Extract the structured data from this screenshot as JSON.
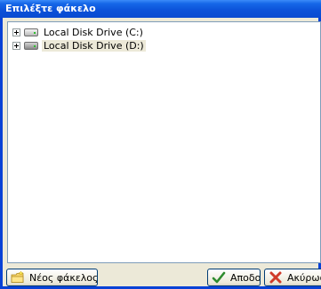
{
  "dialog": {
    "title": "Επιλέξτε φάκελο"
  },
  "tree": {
    "items": [
      {
        "label": "Local Disk Drive (C:)",
        "icon": "hard-drive-icon"
      },
      {
        "label": "Local Disk Drive (D:)",
        "icon": "hard-drive-icon",
        "selected": true
      }
    ]
  },
  "buttons": {
    "new_folder": "Νέος φάκελος",
    "ok": "Αποδοχή",
    "cancel": "Ακύρωση"
  },
  "colors": {
    "titlebar": "#0a4bd1",
    "frame": "#0842d6",
    "ok_check": "#2e8b2e",
    "cancel_x": "#d03b2a"
  }
}
